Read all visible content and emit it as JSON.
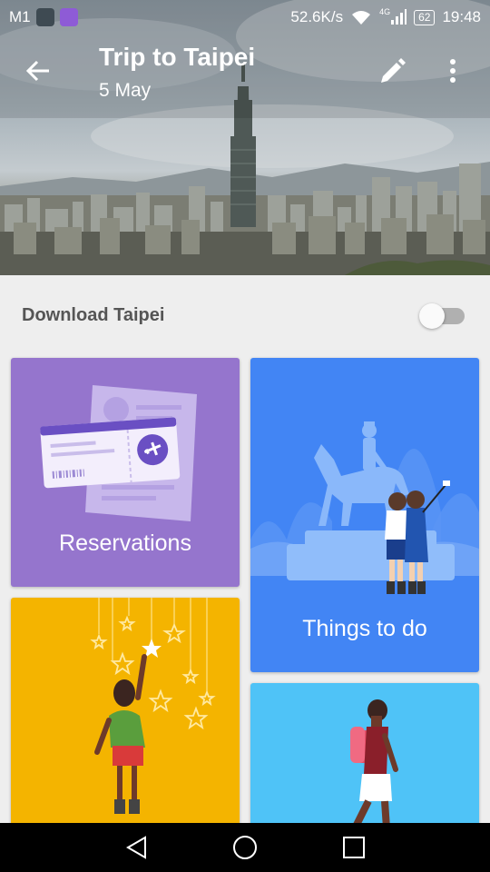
{
  "status_bar": {
    "carrier": "M1",
    "network_speed": "52.6K/s",
    "network_type": "4G",
    "battery": "62",
    "time": "19:48"
  },
  "header": {
    "title": "Trip to Taipei",
    "subtitle": "5 May",
    "back_icon": "arrow-back-icon",
    "edit_icon": "pencil-icon",
    "more_icon": "more-vert-icon"
  },
  "download": {
    "label": "Download Taipei",
    "toggle_on": false
  },
  "cards": [
    {
      "label": "Reservations",
      "color": "#9575cd"
    },
    {
      "label": "Things to do",
      "color": "#4285f4"
    },
    {
      "label": "",
      "color": "#f4b400"
    },
    {
      "label": "",
      "color": "#4fc3f7"
    }
  ],
  "nav": {
    "back_icon": "triangle-back-icon",
    "home_icon": "circle-home-icon",
    "recents_icon": "square-recents-icon"
  }
}
